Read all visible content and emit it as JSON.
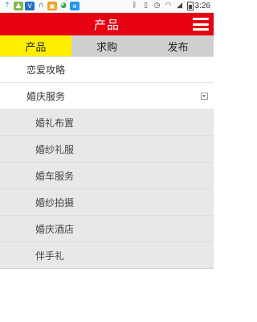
{
  "status_bar": {
    "time": "3:26",
    "icons": [
      "usb-icon",
      "photo-icon",
      "vpn-icon",
      "headset-icon",
      "app-icon",
      "chat-icon",
      "browser-icon",
      "bluetooth-icon",
      "vibrate-icon",
      "alarm-icon",
      "wifi-icon",
      "signal-icon"
    ]
  },
  "header": {
    "title": "产品"
  },
  "tabs": [
    {
      "label": "产品",
      "active": true
    },
    {
      "label": "求购",
      "active": false
    },
    {
      "label": "发布",
      "active": false
    }
  ],
  "menu": {
    "items": [
      {
        "label": "恋爱攻略"
      },
      {
        "label": "婚庆服务",
        "expanded": true
      }
    ],
    "submenu": [
      {
        "label": "婚礼布置"
      },
      {
        "label": "婚纱礼服"
      },
      {
        "label": "婚车服务"
      },
      {
        "label": "婚纱拍摄"
      },
      {
        "label": "婚庆酒店"
      },
      {
        "label": "伴手礼"
      }
    ]
  },
  "colors": {
    "header_red": "#e60012",
    "active_tab": "#ffee00",
    "inactive_tab": "#cfcfcf",
    "submenu_bg": "#e8e8e8"
  }
}
